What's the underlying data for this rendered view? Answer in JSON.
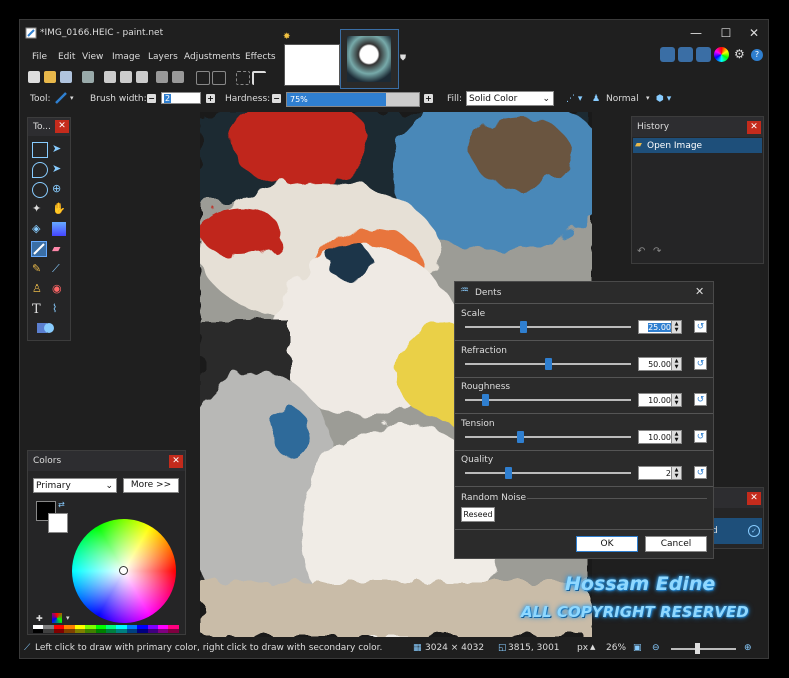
{
  "window": {
    "title": "*IMG_0166.HEIC - paint.net",
    "controls": {
      "minimize": "—",
      "maximize": "☐",
      "close": "✕"
    }
  },
  "menu": [
    "File",
    "Edit",
    "View",
    "Image",
    "Layers",
    "Adjustments",
    "Effects"
  ],
  "toolbar_options": {
    "tool_label": "Tool:",
    "brush_width_label": "Brush width:",
    "brush_width_value": "2",
    "hardness_label": "Hardness:",
    "hardness_value": "75%",
    "hardness_fraction": 0.75,
    "fill_label": "Fill:",
    "fill_value": "Solid Color",
    "blend_mode": "Normal"
  },
  "tools_panel": {
    "title": "To...",
    "close": "✕"
  },
  "history_panel": {
    "title": "History",
    "close": "✕",
    "items": [
      "Open Image"
    ]
  },
  "layers_panel": {
    "close": "✕",
    "partial_text": "d"
  },
  "colors_panel": {
    "title": "Colors",
    "close": "✕",
    "mode": "Primary",
    "more_button": "More >>",
    "palette": [
      "#ffffff",
      "#808080",
      "#ff0000",
      "#ff7f00",
      "#ffff00",
      "#7fff00",
      "#00ff00",
      "#00ff7f",
      "#00ffff",
      "#007fff",
      "#0000ff",
      "#7f00ff",
      "#ff00ff",
      "#ff007f",
      "#000000",
      "#404040",
      "#800000",
      "#804000",
      "#808000",
      "#408000",
      "#008000",
      "#008040",
      "#008080",
      "#004080",
      "#000080",
      "#400080",
      "#800080",
      "#800040"
    ]
  },
  "dents_dialog": {
    "title": "Dents",
    "close": "✕",
    "params": [
      {
        "label": "Scale",
        "value": "25.00",
        "fraction": 0.35
      },
      {
        "label": "Refraction",
        "value": "50.00",
        "fraction": 0.5
      },
      {
        "label": "Roughness",
        "value": "10.00",
        "fraction": 0.12
      },
      {
        "label": "Tension",
        "value": "10.00",
        "fraction": 0.33
      },
      {
        "label": "Quality",
        "value": "2",
        "fraction": 0.26
      }
    ],
    "random_noise_label": "Random Noise",
    "reseed_button": "Reseed",
    "ok_button": "OK",
    "cancel_button": "Cancel"
  },
  "status": {
    "hint": "Left click to draw with primary color, right click to draw with secondary color.",
    "image_size": "3024 × 4032",
    "cursor_pos": "3815, 3001",
    "units": "px",
    "zoom": "26%"
  },
  "watermark": {
    "line1": "Hossam Edine",
    "line2": "ALL COPYRIGHT RESERVED"
  }
}
